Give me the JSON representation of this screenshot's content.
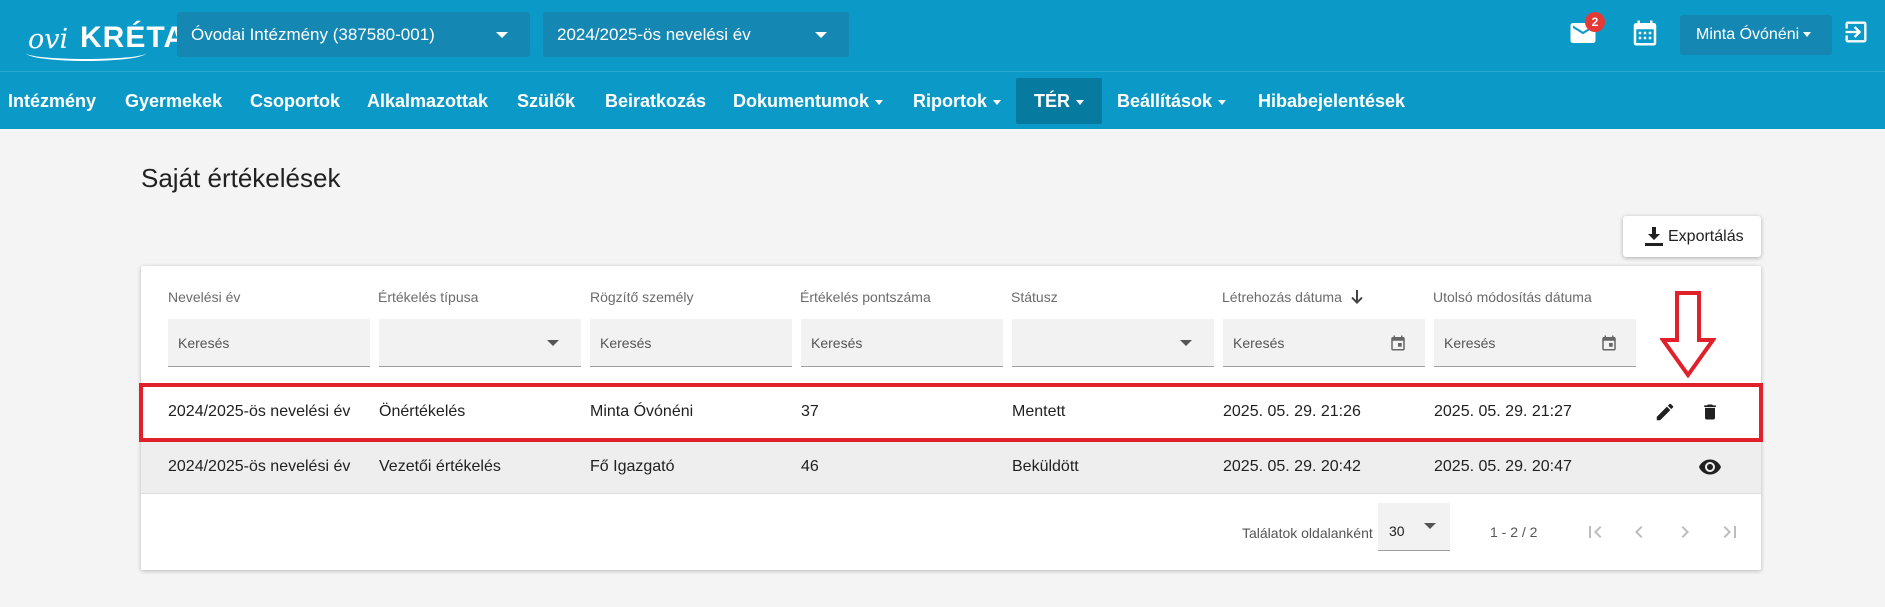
{
  "header": {
    "logo": "oviKRÉTA",
    "institution_select": "Óvodai Intézmény (387580-001)",
    "year_select": "2024/2025-ös nevelési év",
    "mail_badge": "2",
    "user_menu": "Minta Óvónéni"
  },
  "nav": {
    "items": [
      {
        "label": "Intézmény",
        "dropdown": false
      },
      {
        "label": "Gyermekek",
        "dropdown": false
      },
      {
        "label": "Csoportok",
        "dropdown": false
      },
      {
        "label": "Alkalmazottak",
        "dropdown": false
      },
      {
        "label": "Szülők",
        "dropdown": false
      },
      {
        "label": "Beiratkozás",
        "dropdown": false
      },
      {
        "label": "Dokumentumok",
        "dropdown": true
      },
      {
        "label": "Riportok",
        "dropdown": true
      },
      {
        "label": "TÉR",
        "dropdown": true,
        "active": true
      },
      {
        "label": "Beállítások",
        "dropdown": true
      },
      {
        "label": "Hibabejelentések",
        "dropdown": false
      }
    ]
  },
  "page": {
    "title": "Saját értékelések",
    "export_label": "Exportálás"
  },
  "table": {
    "columns": [
      {
        "label": "Nevelési év",
        "filter": "Keresés",
        "filter_type": "text"
      },
      {
        "label": "Értékelés típusa",
        "filter": "",
        "filter_type": "select"
      },
      {
        "label": "Rögzítő személy",
        "filter": "Keresés",
        "filter_type": "text"
      },
      {
        "label": "Értékelés pontszáma",
        "filter": "Keresés",
        "filter_type": "text"
      },
      {
        "label": "Státusz",
        "filter": "",
        "filter_type": "select"
      },
      {
        "label": "Létrehozás dátuma",
        "filter": "Keresés",
        "filter_type": "date",
        "sorted": "desc"
      },
      {
        "label": "Utolsó módosítás dátuma",
        "filter": "Keresés",
        "filter_type": "date"
      }
    ],
    "rows": [
      {
        "cells": [
          "2024/2025-ös nevelési év",
          "Önértékelés",
          "Minta Óvónéni",
          "37",
          "Mentett",
          "2025. 05. 29. 21:26",
          "2025. 05. 29. 21:27"
        ],
        "actions": [
          "edit-icon",
          "delete-icon"
        ],
        "highlighted": true
      },
      {
        "cells": [
          "2024/2025-ös nevelési év",
          "Vezetői értékelés",
          "Fő Igazgató",
          "46",
          "Beküldött",
          "2025. 05. 29. 20:42",
          "2025. 05. 29. 20:47"
        ],
        "actions": [
          "view-icon"
        ]
      }
    ]
  },
  "pager": {
    "per_page_label": "Találatok oldalanként",
    "per_page_value": "30",
    "range": "1 - 2 / 2"
  },
  "colors": {
    "primary": "#0b9ac7",
    "nav_active": "#067a9f",
    "highlight": "#e0202a",
    "badge": "#e53935"
  }
}
